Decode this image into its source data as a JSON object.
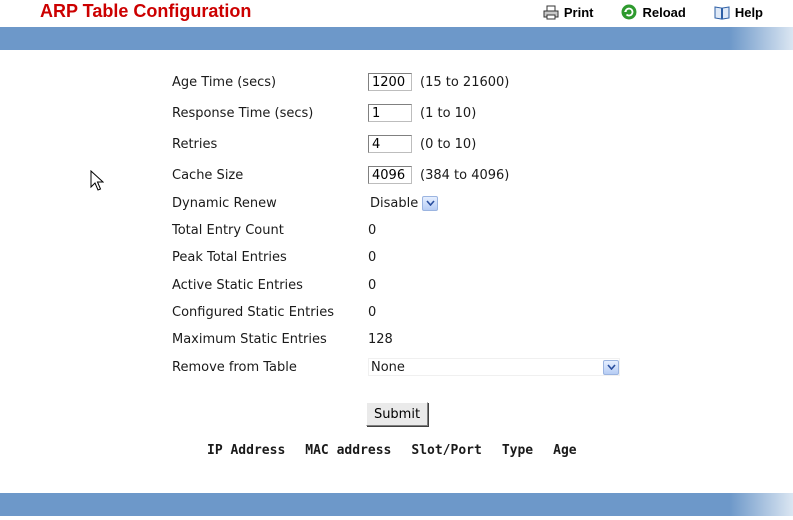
{
  "page": {
    "title": "ARP Table Configuration"
  },
  "toolbar": {
    "print": "Print",
    "reload": "Reload",
    "help": "Help"
  },
  "form": {
    "age_time": {
      "label": "Age Time (secs)",
      "value": "1200",
      "range": "(15 to 21600)"
    },
    "response_time": {
      "label": "Response Time (secs)",
      "value": "1",
      "range": "(1 to 10)"
    },
    "retries": {
      "label": "Retries",
      "value": "4",
      "range": "(0 to 10)"
    },
    "cache_size": {
      "label": "Cache Size",
      "value": "4096",
      "range": "(384 to 4096)"
    },
    "dynamic_renew": {
      "label": "Dynamic Renew",
      "value": "Disable"
    },
    "total_entry_count": {
      "label": "Total Entry Count",
      "value": "0"
    },
    "peak_total_entries": {
      "label": "Peak Total Entries",
      "value": "0"
    },
    "active_static_entries": {
      "label": "Active Static Entries",
      "value": "0"
    },
    "configured_static_entries": {
      "label": "Configured Static Entries",
      "value": "0"
    },
    "maximum_static_entries": {
      "label": "Maximum Static Entries",
      "value": "128"
    },
    "remove_from_table": {
      "label": "Remove from Table",
      "value": "None"
    },
    "submit_label": "Submit"
  },
  "table": {
    "columns": [
      "IP Address",
      "MAC address",
      "Slot/Port",
      "Type",
      "Age"
    ]
  },
  "colors": {
    "title": "#cc0000",
    "band": "#6d98c9"
  }
}
